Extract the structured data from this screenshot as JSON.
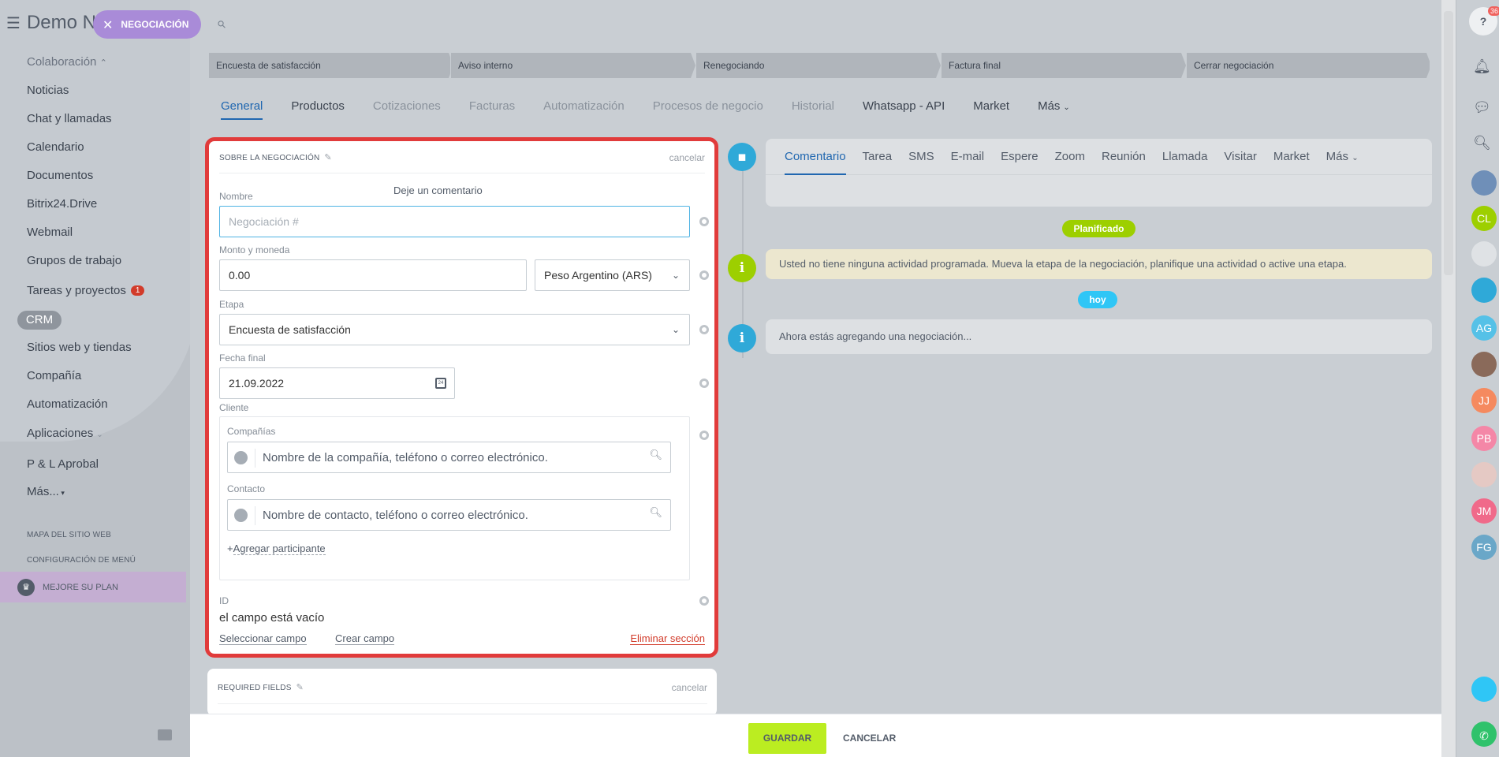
{
  "sidebar": {
    "title": "Demo N",
    "deal_pill": "NEGOCIACIÓN",
    "group_label": "Colaboración",
    "items": [
      "Noticias",
      "Chat y llamadas",
      "Calendario",
      "Documentos",
      "Bitrix24.Drive",
      "Webmail",
      "Grupos de trabajo"
    ],
    "tasks_label": "Tareas y proyectos",
    "tasks_badge": "1",
    "crm": "CRM",
    "items2": [
      "Sitios web y tiendas",
      "Compañía",
      "Automatización"
    ],
    "apps": "Aplicaciones",
    "pl": "P & L Aprobal",
    "more": "Más...",
    "sitemap": "MAPA DEL SITIO WEB",
    "menu_config": "CONFIGURACIÓN DE MENÚ",
    "upgrade": "MEJORE SU PLAN"
  },
  "stages": [
    "Encuesta de satisfacción",
    "Aviso interno",
    "Renegociando",
    "Factura final",
    "Cerrar negociación"
  ],
  "tabs": [
    {
      "label": "General"
    },
    {
      "label": "Productos"
    },
    {
      "label": "Cotizaciones"
    },
    {
      "label": "Facturas"
    },
    {
      "label": "Automatización"
    },
    {
      "label": "Procesos de negocio"
    },
    {
      "label": "Historial"
    },
    {
      "label": "Whatsapp - API"
    },
    {
      "label": "Market"
    },
    {
      "label": "Más"
    }
  ],
  "form": {
    "section_title": "SOBRE LA NEGOCIACIÓN",
    "cancel": "cancelar",
    "name_label": "Nombre",
    "name_placeholder": "Negociación #",
    "amount_label": "Monto y moneda",
    "amount_value": "0.00",
    "currency_value": "Peso Argentino (ARS)",
    "stage_label": "Etapa",
    "stage_value": "Encuesta de satisfacción",
    "date_label": "Fecha final",
    "date_value": "21.09.2022",
    "client_label": "Cliente",
    "companies_label": "Compañías",
    "companies_placeholder": "Nombre de la compañía, teléfono o correo electrónico.",
    "contact_label": "Contacto",
    "contact_placeholder": "Nombre de contacto, teléfono o correo electrónico.",
    "add_participant": "Agregar participante",
    "id_label": "ID",
    "id_value": "el campo está vacío",
    "select_field": "Seleccionar campo",
    "create_field": "Crear campo",
    "delete_section": "Eliminar sección"
  },
  "required": {
    "title": "REQUIRED FIELDS",
    "cancel": "cancelar"
  },
  "timeline": {
    "tabs": [
      "Comentario",
      "Tarea",
      "SMS",
      "E-mail",
      "Espere",
      "Zoom",
      "Reunión",
      "Llamada",
      "Visitar",
      "Market",
      "Más"
    ],
    "composer_placeholder": "Deje un comentario",
    "planned_pill": "Planificado",
    "no_activity": "Usted no tiene ninguna actividad programada. Mueva la etapa de la negociación, planifique una actividad o active una etapa.",
    "today_pill": "hoy",
    "adding": "Ahora estás agregando una negociación..."
  },
  "rightbar": {
    "help_badge": "36",
    "avatars": [
      "CL",
      "AG",
      "JJ",
      "PB",
      "JM",
      "FG"
    ]
  },
  "footer": {
    "save": "GUARDAR",
    "cancel": "CANCELAR"
  },
  "colors": {
    "accent": "#2067b0",
    "highlight": "#e13b3b",
    "save": "#bbed21",
    "planned": "#9dcf00",
    "today": "#2fc6f6"
  }
}
